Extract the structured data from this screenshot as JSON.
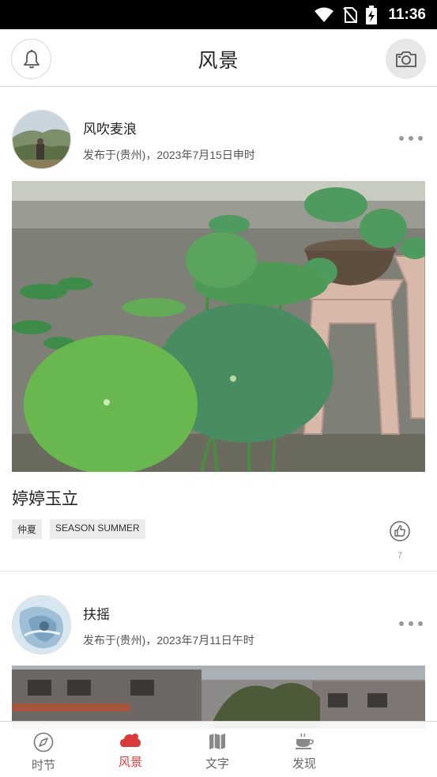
{
  "status_bar": {
    "time": "11:36"
  },
  "header": {
    "title": "风景"
  },
  "posts": [
    {
      "author": "风吹麦浪",
      "meta": "发布于(贵州)，2023年7月15日申时",
      "caption": "婷婷玉立",
      "tags": [
        "仲夏",
        "SEASON SUMMER"
      ],
      "likes": "7"
    },
    {
      "author": "扶摇",
      "meta": "发布于(贵州)，2023年7月11日午时"
    }
  ],
  "nav": [
    {
      "label": "时节",
      "icon": "compass-icon",
      "active": false
    },
    {
      "label": "风景",
      "icon": "cloud-icon",
      "active": true
    },
    {
      "label": "文字",
      "icon": "map-icon",
      "active": false
    },
    {
      "label": "发现",
      "icon": "tea-cup-icon",
      "active": false
    }
  ],
  "colors": {
    "accent": "#d93b3b",
    "nav_text": "#666666",
    "status_bar": "#000000"
  }
}
